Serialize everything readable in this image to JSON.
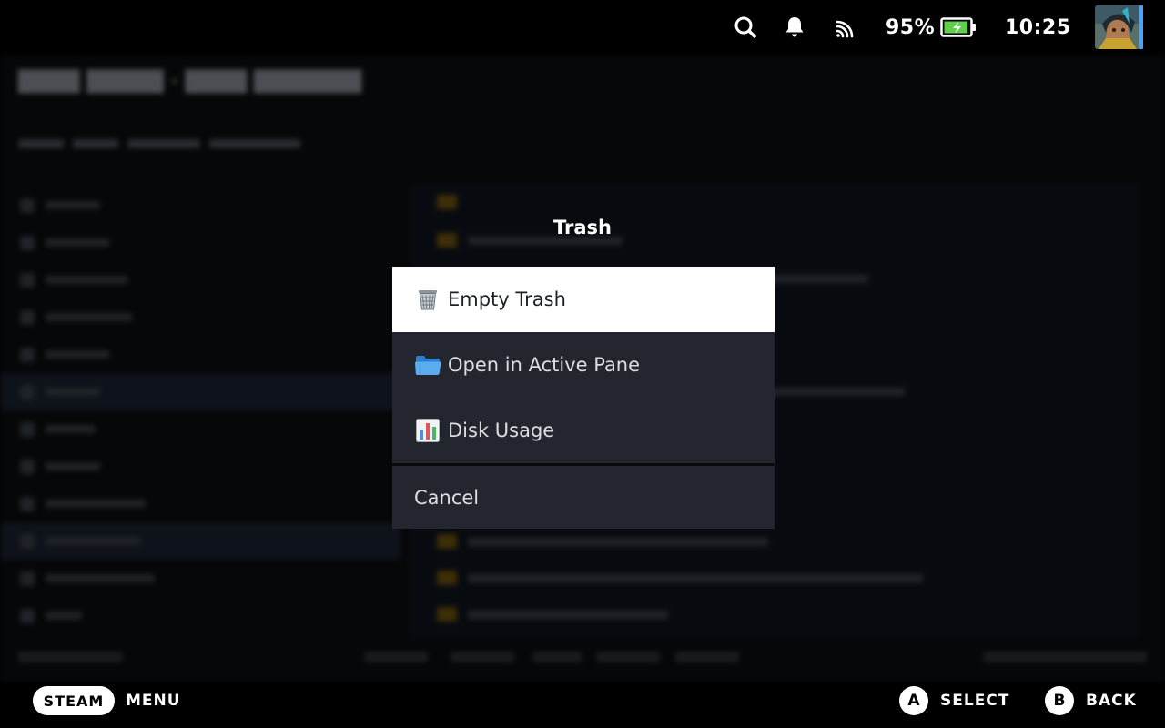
{
  "status_bar": {
    "battery_percent": "95%",
    "battery_level": 0.95,
    "clock": "10:25",
    "icons": [
      "search-icon",
      "bell-icon",
      "cast-icon",
      "battery-icon"
    ]
  },
  "dialog": {
    "title": "Trash",
    "items": [
      {
        "label": "Empty Trash",
        "icon": "wastebasket-icon"
      },
      {
        "label": "Open in Active Pane",
        "icon": "open-folder-icon"
      },
      {
        "label": "Disk Usage",
        "icon": "bar-chart-icon"
      }
    ],
    "cancel_label": "Cancel"
  },
  "footer": {
    "steam_label": "STEAM",
    "menu_label": "MENU",
    "a_glyph": "A",
    "select_label": "SELECT",
    "b_glyph": "B",
    "back_label": "BACK"
  },
  "colors": {
    "menu_bg": "#23262e",
    "menu_active_bg": "#ffffff",
    "accent": "#4aa3ff",
    "battery_fill": "#5ed04a"
  }
}
